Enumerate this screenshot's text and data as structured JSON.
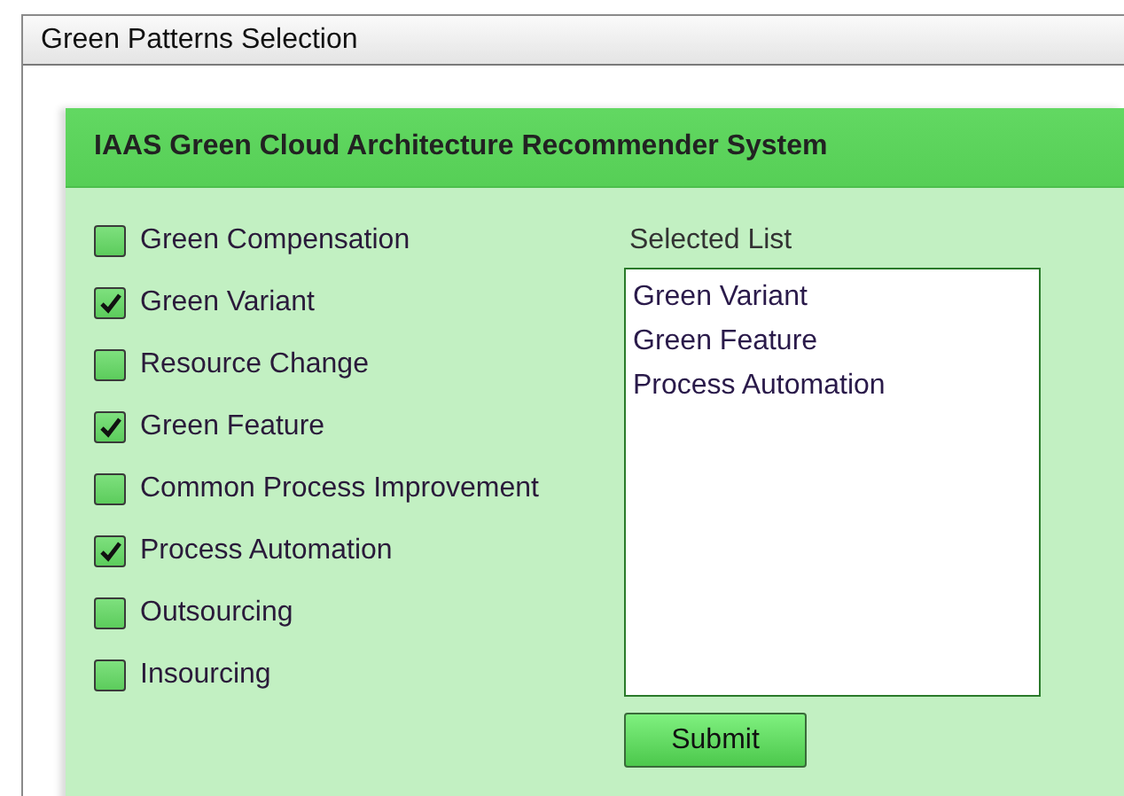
{
  "window": {
    "title": "Green Patterns Selection"
  },
  "panel": {
    "title": "IAAS Green Cloud Architecture Recommender System"
  },
  "patterns": [
    {
      "label": "Green Compensation",
      "checked": false
    },
    {
      "label": "Green Variant",
      "checked": true
    },
    {
      "label": "Resource Change",
      "checked": false
    },
    {
      "label": "Green Feature",
      "checked": true
    },
    {
      "label": "Common Process Improvement",
      "checked": false
    },
    {
      "label": "Process Automation",
      "checked": true
    },
    {
      "label": "Outsourcing",
      "checked": false
    },
    {
      "label": "Insourcing",
      "checked": false
    }
  ],
  "selected_list": {
    "label": "Selected List",
    "items": [
      "Green Variant",
      "Green Feature",
      "Process Automation"
    ]
  },
  "buttons": [
    "Submit"
  ]
}
